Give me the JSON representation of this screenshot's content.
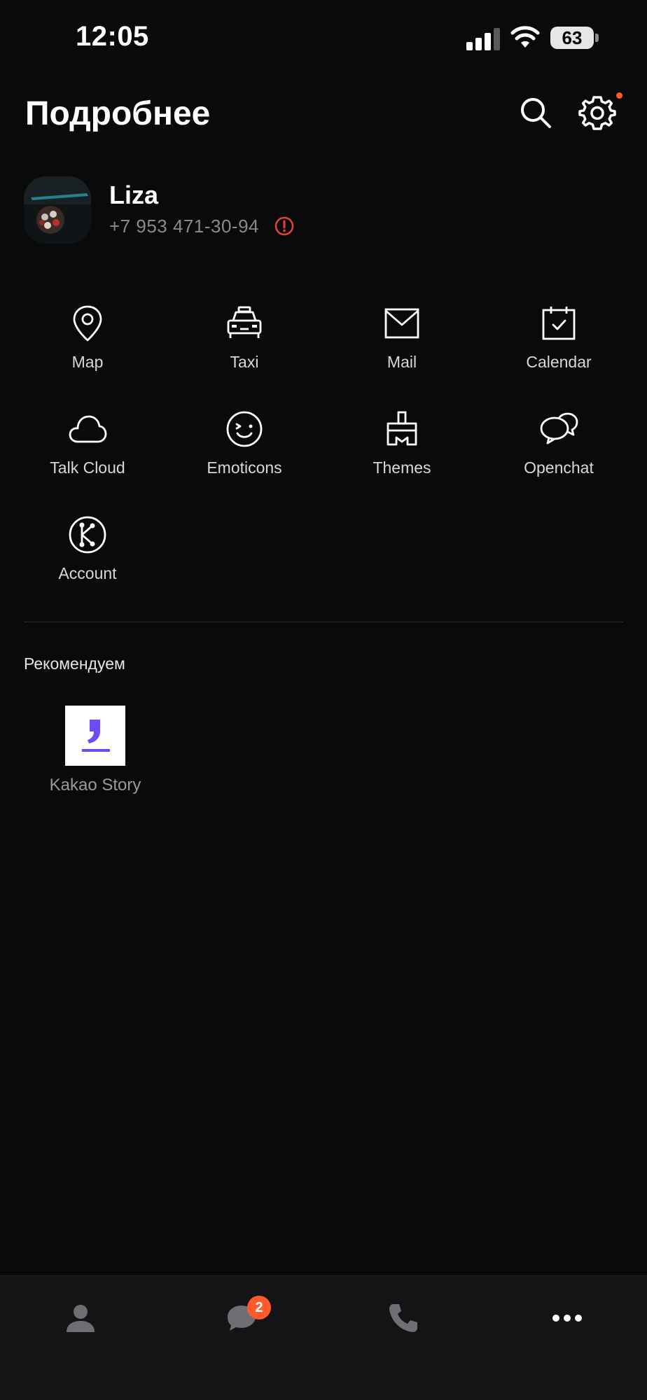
{
  "status": {
    "time": "12:05",
    "battery": "63"
  },
  "header": {
    "title": "Подробнее"
  },
  "profile": {
    "name": "Liza",
    "phone": "+7 953 471-30-94"
  },
  "services": [
    {
      "label": "Map",
      "icon": "map-pin-icon"
    },
    {
      "label": "Taxi",
      "icon": "taxi-icon"
    },
    {
      "label": "Mail",
      "icon": "mail-icon"
    },
    {
      "label": "Calendar",
      "icon": "calendar-icon"
    },
    {
      "label": "Talk Cloud",
      "icon": "cloud-icon"
    },
    {
      "label": "Emoticons",
      "icon": "emoticon-icon"
    },
    {
      "label": "Themes",
      "icon": "brush-icon"
    },
    {
      "label": "Openchat",
      "icon": "chat-bubbles-icon"
    },
    {
      "label": "Account",
      "icon": "kakao-account-icon"
    }
  ],
  "recommended": {
    "title": "Рекомендуем",
    "items": [
      {
        "label": "Kakao Story",
        "icon": "kakao-story-icon"
      }
    ]
  },
  "tabbar": {
    "items": [
      {
        "name": "friends",
        "icon": "person-icon"
      },
      {
        "name": "chats",
        "icon": "chat-icon",
        "badge": "2"
      },
      {
        "name": "calls",
        "icon": "phone-icon"
      },
      {
        "name": "more",
        "icon": "more-dots-icon"
      }
    ]
  },
  "colors": {
    "accent": "#ff5a2a",
    "background": "#0a0a0a",
    "tabbar": "#141416",
    "story_purple": "#6b4cf6"
  }
}
